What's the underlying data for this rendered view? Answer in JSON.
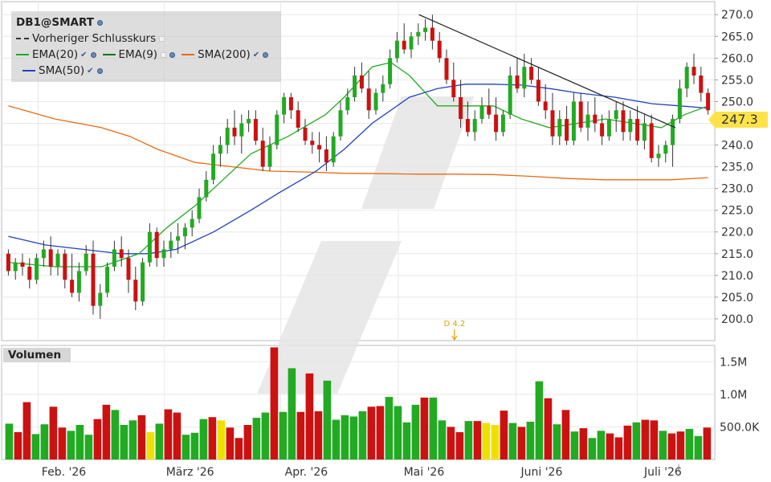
{
  "colors": {
    "up": "#22aa22",
    "down": "#cc1111",
    "neutral": "#f0e000",
    "ema20": "#22aa22",
    "ema9": "#117711",
    "sma200": "#e86a14",
    "sma50": "#2040c0",
    "trendline": "#222222",
    "price_tag": "#ffe24a",
    "grid": "#e8e8e8",
    "legend_bg": "#c8c8c8"
  },
  "legend": {
    "symbol": "DB1@SMART",
    "prev_close": "Vorheriger Schlusskurs",
    "ema20": "EMA(20)",
    "ema9": "EMA(9)",
    "sma200": "SMA(200)",
    "sma50": "SMA(50)"
  },
  "volume_label": "Volumen",
  "last_price": "247.3",
  "event_marker": "D 4.2",
  "chart_data": {
    "type": "candlestick",
    "title": "DB1@SMART",
    "price_axis": {
      "ticks": [
        "200.0",
        "205.0",
        "210.0",
        "215.0",
        "220.0",
        "225.0",
        "230.0",
        "235.0",
        "240.0",
        "245.0",
        "250.0",
        "255.0",
        "260.0",
        "265.0",
        "270.0"
      ],
      "ylim": [
        195,
        273
      ]
    },
    "volume_axis": {
      "ticks": [
        "500.0K",
        "1.0M",
        "1.5M"
      ],
      "ylim": [
        0,
        1.75
      ]
    },
    "x_ticks": [
      "Feb. '26",
      "März '26",
      "Apr. '26",
      "Mai '26",
      "Juni '26",
      "Juli '26"
    ],
    "ohlc": [
      [
        215,
        216,
        210,
        211
      ],
      [
        211,
        214,
        209,
        213
      ],
      [
        213,
        215,
        210,
        212
      ],
      [
        212,
        214,
        207,
        209
      ],
      [
        209,
        215,
        208,
        214
      ],
      [
        214,
        218,
        212,
        216
      ],
      [
        216,
        219,
        210,
        212
      ],
      [
        212,
        216,
        210,
        215
      ],
      [
        215,
        216,
        207,
        209
      ],
      [
        209,
        215,
        205,
        206
      ],
      [
        206,
        213,
        204,
        211
      ],
      [
        211,
        217,
        210,
        215
      ],
      [
        215,
        218,
        201,
        203
      ],
      [
        203,
        208,
        200,
        206
      ],
      [
        206,
        213,
        205,
        212
      ],
      [
        212,
        218,
        211,
        216
      ],
      [
        216,
        219,
        212,
        214
      ],
      [
        214,
        216,
        206,
        209
      ],
      [
        209,
        212,
        202,
        204
      ],
      [
        204,
        214,
        203,
        213
      ],
      [
        213,
        222,
        212,
        220
      ],
      [
        220,
        221,
        212,
        214
      ],
      [
        214,
        218,
        212,
        216
      ],
      [
        216,
        220,
        214,
        218
      ],
      [
        218,
        222,
        215,
        219
      ],
      [
        219,
        222,
        216,
        221
      ],
      [
        221,
        225,
        219,
        223
      ],
      [
        223,
        230,
        222,
        228
      ],
      [
        228,
        234,
        227,
        232
      ],
      [
        232,
        240,
        231,
        238
      ],
      [
        238,
        242,
        235,
        240
      ],
      [
        240,
        246,
        238,
        244
      ],
      [
        244,
        248,
        240,
        242
      ],
      [
        242,
        247,
        238,
        245
      ],
      [
        245,
        248,
        243,
        246
      ],
      [
        246,
        248,
        240,
        241
      ],
      [
        241,
        244,
        234,
        235
      ],
      [
        235,
        242,
        234,
        240
      ],
      [
        240,
        248,
        239,
        247
      ],
      [
        247,
        252,
        245,
        251
      ],
      [
        251,
        252,
        246,
        248
      ],
      [
        248,
        250,
        243,
        244
      ],
      [
        244,
        246,
        240,
        241
      ],
      [
        241,
        243,
        238,
        240
      ],
      [
        240,
        243,
        236,
        239
      ],
      [
        239,
        242,
        234,
        236
      ],
      [
        236,
        243,
        235,
        242
      ],
      [
        242,
        250,
        241,
        248
      ],
      [
        248,
        253,
        247,
        251
      ],
      [
        251,
        258,
        250,
        256
      ],
      [
        256,
        259,
        252,
        253
      ],
      [
        253,
        257,
        246,
        248
      ],
      [
        248,
        253,
        247,
        252
      ],
      [
        252,
        256,
        250,
        254
      ],
      [
        254,
        262,
        253,
        260
      ],
      [
        260,
        266,
        259,
        264
      ],
      [
        264,
        268,
        261,
        262
      ],
      [
        262,
        266,
        260,
        265
      ],
      [
        265,
        268,
        263,
        266
      ],
      [
        266,
        269,
        264,
        267
      ],
      [
        267,
        270,
        262,
        264
      ],
      [
        264,
        266,
        259,
        260
      ],
      [
        260,
        262,
        254,
        255
      ],
      [
        255,
        259,
        250,
        251
      ],
      [
        251,
        255,
        244,
        246
      ],
      [
        246,
        250,
        242,
        243
      ],
      [
        243,
        248,
        241,
        246
      ],
      [
        246,
        251,
        245,
        249
      ],
      [
        249,
        253,
        246,
        247
      ],
      [
        247,
        251,
        241,
        243
      ],
      [
        243,
        248,
        242,
        247
      ],
      [
        247,
        258,
        246,
        256
      ],
      [
        256,
        260,
        252,
        253
      ],
      [
        253,
        261,
        251,
        258
      ],
      [
        258,
        260,
        254,
        255
      ],
      [
        255,
        258,
        249,
        250
      ],
      [
        250,
        254,
        246,
        248
      ],
      [
        248,
        252,
        240,
        242
      ],
      [
        242,
        248,
        240,
        246
      ],
      [
        246,
        249,
        240,
        241
      ],
      [
        241,
        252,
        240,
        250
      ],
      [
        250,
        252,
        243,
        244
      ],
      [
        244,
        250,
        241,
        247
      ],
      [
        247,
        251,
        243,
        245
      ],
      [
        245,
        247,
        240,
        242
      ],
      [
        242,
        248,
        241,
        246
      ],
      [
        246,
        250,
        243,
        248
      ],
      [
        248,
        250,
        241,
        243
      ],
      [
        243,
        248,
        241,
        246
      ],
      [
        246,
        249,
        240,
        241
      ],
      [
        241,
        247,
        239,
        245
      ],
      [
        245,
        247,
        236,
        237
      ],
      [
        237,
        240,
        235,
        238
      ],
      [
        238,
        241,
        236,
        240
      ],
      [
        240,
        247,
        235,
        246
      ],
      [
        246,
        255,
        245,
        253
      ],
      [
        253,
        259,
        251,
        258
      ],
      [
        258,
        261,
        254,
        256
      ],
      [
        256,
        258,
        250,
        252
      ],
      [
        252,
        253,
        247,
        248
      ]
    ],
    "volume_m": [
      0.55,
      0.42,
      0.88,
      0.39,
      0.54,
      0.81,
      0.49,
      0.44,
      0.53,
      0.38,
      0.62,
      0.84,
      0.76,
      0.53,
      0.6,
      0.68,
      0.42,
      0.55,
      0.77,
      0.72,
      0.38,
      0.41,
      0.62,
      0.65,
      0.6,
      0.49,
      0.33,
      0.53,
      0.64,
      0.72,
      1.72,
      0.73,
      1.4,
      0.73,
      1.32,
      0.74,
      1.21,
      0.61,
      0.68,
      0.66,
      0.74,
      0.81,
      0.82,
      0.96,
      0.82,
      0.57,
      0.84,
      0.95,
      0.95,
      0.6,
      0.5,
      0.42,
      0.59,
      0.59,
      0.56,
      0.53,
      0.75,
      0.56,
      0.5,
      0.58,
      1.2,
      0.94,
      0.54,
      0.76,
      0.43,
      0.48,
      0.33,
      0.44,
      0.4,
      0.34,
      0.52,
      0.57,
      0.61,
      0.6,
      0.44,
      0.4,
      0.43,
      0.47,
      0.36,
      0.49
    ],
    "volume_colors": "udduudduuudduuudnudduuudnddduuduuddduuuuudduuuuduuddudnnduduudududuuddduddudduudd",
    "ema20": [
      [
        0,
        213
      ],
      [
        10,
        212
      ],
      [
        20,
        212
      ],
      [
        28,
        215
      ],
      [
        34,
        221
      ],
      [
        40,
        226
      ],
      [
        46,
        232
      ],
      [
        52,
        238
      ],
      [
        60,
        242
      ],
      [
        68,
        247
      ],
      [
        72,
        251
      ],
      [
        78,
        258
      ],
      [
        82,
        259
      ],
      [
        86,
        256
      ],
      [
        92,
        249
      ],
      [
        98,
        249
      ],
      [
        104,
        249
      ],
      [
        110,
        246
      ],
      [
        116,
        244
      ],
      [
        122,
        245
      ],
      [
        128,
        246
      ],
      [
        134,
        245
      ],
      [
        140,
        244
      ],
      [
        145,
        247
      ],
      [
        150,
        249
      ]
    ],
    "sma200": [
      [
        0,
        249
      ],
      [
        10,
        246
      ],
      [
        20,
        244
      ],
      [
        26,
        242
      ],
      [
        32,
        239
      ],
      [
        40,
        236
      ],
      [
        48,
        235
      ],
      [
        56,
        234
      ],
      [
        64,
        233.8
      ],
      [
        72,
        233.5
      ],
      [
        80,
        233.4
      ],
      [
        88,
        233.3
      ],
      [
        96,
        233.3
      ],
      [
        104,
        233.2
      ],
      [
        112,
        232.8
      ],
      [
        120,
        232.3
      ],
      [
        128,
        232
      ],
      [
        136,
        232
      ],
      [
        142,
        232
      ],
      [
        150,
        232.5
      ]
    ],
    "sma50": [
      [
        0,
        219
      ],
      [
        8,
        217
      ],
      [
        16,
        216
      ],
      [
        24,
        215
      ],
      [
        30,
        215
      ],
      [
        36,
        216
      ],
      [
        44,
        220
      ],
      [
        52,
        225
      ],
      [
        58,
        229
      ],
      [
        66,
        234
      ],
      [
        72,
        239
      ],
      [
        78,
        245
      ],
      [
        86,
        251
      ],
      [
        92,
        253
      ],
      [
        98,
        254
      ],
      [
        104,
        254
      ],
      [
        110,
        253.8
      ],
      [
        116,
        253
      ],
      [
        122,
        252
      ],
      [
        130,
        251
      ],
      [
        138,
        249.5
      ],
      [
        144,
        249
      ],
      [
        150,
        248.5
      ]
    ],
    "trendline": [
      [
        88,
        270
      ],
      [
        143,
        244
      ]
    ]
  }
}
